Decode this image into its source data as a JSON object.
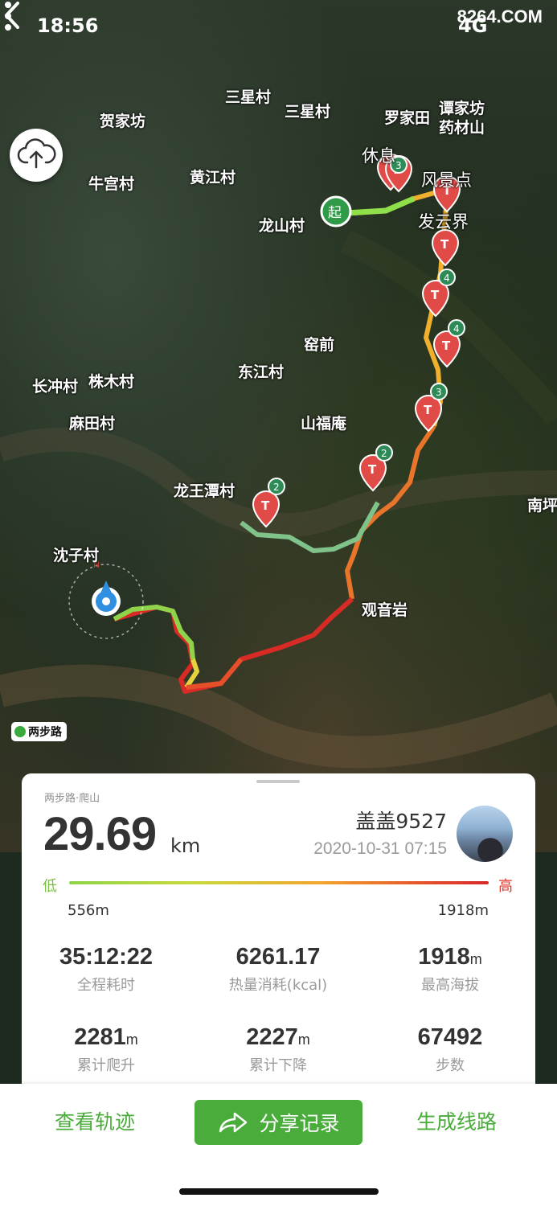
{
  "status": {
    "time": "18:56",
    "network": "4G"
  },
  "watermark": "8264.COM",
  "map": {
    "villages": [
      "三星村",
      "三星村",
      "贺家坊",
      "罗家田",
      "谭家坊",
      "药材山",
      "牛宫村",
      "黄江村",
      "龙山村",
      "窑前",
      "东江村",
      "长冲村",
      "株木村",
      "麻田村",
      "山福庵",
      "龙王潭村",
      "沈子村",
      "观音岩",
      "南坪"
    ],
    "pois": {
      "rest": "休息",
      "scenic": "风景点",
      "fayun": "发云界"
    },
    "start_label": "起",
    "marker_counts": [
      "3",
      "4",
      "4",
      "3",
      "2",
      "2"
    ],
    "compass": "N",
    "brand": "两步路"
  },
  "summary": {
    "source": "两步路·爬山",
    "distance": "29.69",
    "distance_unit": "km",
    "user": "盖盖9527",
    "datetime": "2020-10-31 07:15",
    "low_label": "低",
    "high_label": "高",
    "elev_min": "556m",
    "elev_max": "1918m"
  },
  "stats": [
    {
      "value": "35:12:22",
      "unit": "",
      "label": "全程耗时"
    },
    {
      "value": "6261.17",
      "unit": "",
      "label": "热量消耗(kcal)"
    },
    {
      "value": "1918",
      "unit": "m",
      "label": "最高海拔"
    },
    {
      "value": "2281",
      "unit": "m",
      "label": "累计爬升"
    },
    {
      "value": "2227",
      "unit": "m",
      "label": "累计下降"
    },
    {
      "value": "67492",
      "unit": "",
      "label": "步数"
    }
  ],
  "actions": {
    "view_track": "查看轨迹",
    "share": "分享记录",
    "generate_route": "生成线路"
  },
  "colors": {
    "accent": "#4aac3a",
    "low": "#7bc043",
    "high": "#e0382a"
  },
  "icons": [
    "back-icon",
    "more-icon",
    "cloud-upload-icon",
    "share-arrow-icon",
    "compass-icon",
    "waypoint-pin-icon"
  ]
}
